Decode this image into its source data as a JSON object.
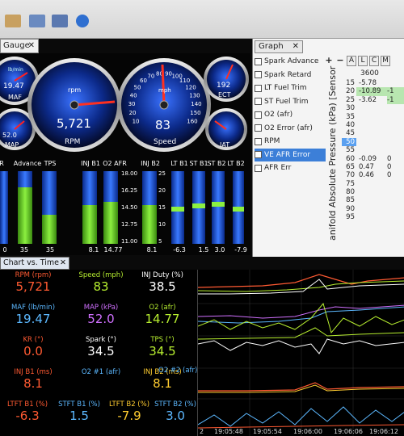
{
  "gauge_panel": {
    "tab_label": "Gauge"
  },
  "gauges": {
    "maf": {
      "label": "MAF",
      "value": "19.47",
      "unit": "lb/min"
    },
    "map": {
      "label": "MAP",
      "value": "52.0"
    },
    "rpm": {
      "label": "RPM",
      "unit": "rpm",
      "value": "5,721"
    },
    "speed": {
      "label": "Speed",
      "unit": "mph",
      "value": "83",
      "ticks": [
        "10",
        "20",
        "30",
        "40",
        "50",
        "60",
        "70",
        "80",
        "90",
        "100",
        "110",
        "120",
        "130",
        "140",
        "150",
        "160"
      ]
    },
    "ect": {
      "label": "ECT",
      "value": "192"
    },
    "iat": {
      "label": "IAT"
    }
  },
  "bars": {
    "headers": [
      "R",
      "Advance",
      "TPS",
      "INJ B1",
      "O2 AFR",
      "INJ B2",
      "LT B1",
      "ST B1",
      "ST B2",
      "LT B2"
    ],
    "afr_scale": [
      "18.00",
      "16.25",
      "14.50",
      "12.75",
      "11.00"
    ],
    "inj_scale": [
      "25",
      "20",
      "15",
      "10",
      "5"
    ],
    "bottom_values": [
      "0",
      "35",
      "35",
      "8.1",
      "14.77",
      "8.1",
      "-6.3",
      "1.5",
      "3.0",
      "-7.9"
    ]
  },
  "graph_panel": {
    "tab_label": "Graph",
    "pids": [
      {
        "label": "Spark Advance",
        "selected": false
      },
      {
        "label": "Spark Retard",
        "selected": false
      },
      {
        "label": "LT Fuel Trim",
        "selected": false
      },
      {
        "label": "ST Fuel Trim",
        "selected": false
      },
      {
        "label": "O2 (afr)",
        "selected": false
      },
      {
        "label": "O2 Error (afr)",
        "selected": false
      },
      {
        "label": "RPM",
        "selected": false
      },
      {
        "label": "VE AFR Error",
        "selected": true
      },
      {
        "label": "AFR Err",
        "selected": false
      }
    ],
    "controls": [
      "+",
      "−",
      "A",
      "L",
      "C",
      "M"
    ],
    "axis_label": "anifold Absolute Pressure (kPa) [Sensor",
    "column_header": "3600",
    "rows": [
      {
        "kpa": "15",
        "v1": "-5.78",
        "v2": "",
        "g1": false,
        "g2": false
      },
      {
        "kpa": "20",
        "v1": "-10.89",
        "v2": "-1",
        "g1": true,
        "g2": true
      },
      {
        "kpa": "25",
        "v1": "-3.62",
        "v2": "-1",
        "g1": false,
        "g2": true
      },
      {
        "kpa": "30",
        "v1": "",
        "v2": "",
        "g1": false,
        "g2": false
      },
      {
        "kpa": "35",
        "v1": "",
        "v2": "",
        "g1": false,
        "g2": false
      },
      {
        "kpa": "40",
        "v1": "",
        "v2": "",
        "g1": false,
        "g2": false
      },
      {
        "kpa": "45",
        "v1": "",
        "v2": "",
        "g1": false,
        "g2": false
      },
      {
        "kpa": "50",
        "v1": "",
        "v2": "",
        "g1": false,
        "g2": false,
        "hl": true
      },
      {
        "kpa": "55",
        "v1": "",
        "v2": "",
        "g1": false,
        "g2": false
      },
      {
        "kpa": "60",
        "v1": "-0.09",
        "v2": "0",
        "g1": false,
        "g2": false
      },
      {
        "kpa": "65",
        "v1": "0.47",
        "v2": "0",
        "g1": false,
        "g2": false
      },
      {
        "kpa": "70",
        "v1": "0.46",
        "v2": "0",
        "g1": false,
        "g2": false
      },
      {
        "kpa": "75",
        "v1": "",
        "v2": "",
        "g1": false,
        "g2": false
      },
      {
        "kpa": "80",
        "v1": "",
        "v2": "",
        "g1": false,
        "g2": false
      },
      {
        "kpa": "85",
        "v1": "",
        "v2": "",
        "g1": false,
        "g2": false
      },
      {
        "kpa": "90",
        "v1": "",
        "v2": "",
        "g1": false,
        "g2": false
      },
      {
        "kpa": "95",
        "v1": "",
        "v2": "",
        "g1": false,
        "g2": false
      }
    ]
  },
  "chart_vs_time": {
    "tab_label": "Chart vs. Time",
    "cells": [
      {
        "id": "rpm",
        "label": "RPM (rpm)",
        "value": "5,721",
        "color": "#ff5a32"
      },
      {
        "id": "speed",
        "label": "Speed (mph)",
        "value": "83",
        "color": "#b8f030"
      },
      {
        "id": "injduty",
        "label": "INJ Duty (%)",
        "value": "38.5",
        "color": "#ffffff"
      },
      {
        "id": "maf",
        "label": "MAF (lb/min)",
        "value": "19.47",
        "color": "#5cb8ff"
      },
      {
        "id": "map",
        "label": "MAP (kPa)",
        "value": "52.0",
        "color": "#d070ff"
      },
      {
        "id": "o2",
        "label": "O2 (afr)",
        "value": "14.77",
        "color": "#b8f030"
      },
      {
        "id": "kr",
        "label": "KR (°)",
        "value": "0.0",
        "color": "#ff5a32"
      },
      {
        "id": "spark",
        "label": "Spark (°)",
        "value": "34.5",
        "color": "#ffffff"
      },
      {
        "id": "tps",
        "label": "TPS (°)",
        "value": "34.5",
        "color": "#b8f030"
      },
      {
        "id": "injb1",
        "label": "INJ B1 (ms)",
        "value": "8.1",
        "color": "#ff5a32"
      },
      {
        "id": "o21",
        "label": "O2 #1 (afr)",
        "value": "",
        "color": "#5cb8ff"
      },
      {
        "id": "injb2",
        "label": "INJ B2 (ms)",
        "value": "8.1",
        "color": "#ffcc30"
      },
      {
        "id": "o22",
        "label": "O2 #2 (afr)",
        "value": "",
        "color": "#5cb8ff"
      },
      {
        "id": "ltftb1",
        "label": "LTFT B1 (%)",
        "value": "-6.3",
        "color": "#ff5a32"
      },
      {
        "id": "stftb1",
        "label": "STFT B1 (%)",
        "value": "1.5",
        "color": "#5cb8ff"
      },
      {
        "id": "ltftb2",
        "label": "LTFT B2 (%)",
        "value": "-7.9",
        "color": "#ffcc30"
      },
      {
        "id": "stftb2",
        "label": "STFT B2 (%)",
        "value": "3.0",
        "color": "#5cb8ff"
      }
    ],
    "time_labels": [
      "2",
      "19:05:48",
      "19:05:54",
      "19:06:00",
      "19:06:06",
      "19:06:12"
    ]
  }
}
